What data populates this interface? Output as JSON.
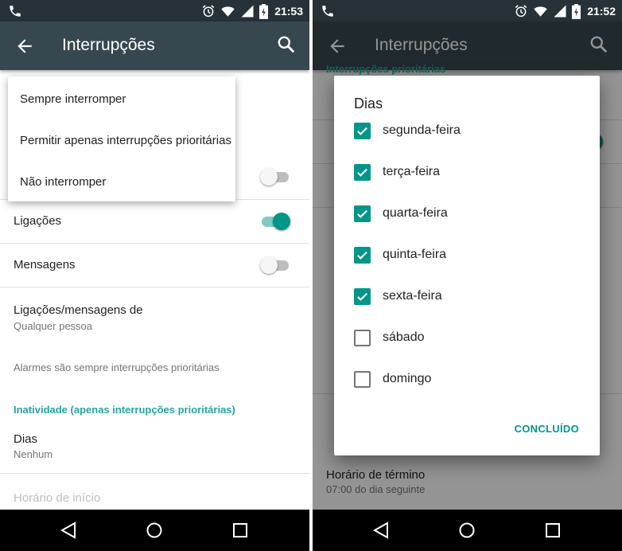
{
  "left_screen": {
    "status": {
      "time": "21:53"
    },
    "appbar": {
      "title": "Interrupções"
    },
    "dropdown": {
      "items": [
        "Sempre interromper",
        "Permitir apenas interrupções prioritárias",
        "Não interromper"
      ]
    },
    "rows": {
      "eventos_toggle": false,
      "ligacoes": {
        "title": "Ligações",
        "on": true
      },
      "mensagens": {
        "title": "Mensagens",
        "on": false
      },
      "ligacoes_mensagens_de": {
        "title": "Ligações/mensagens de",
        "subtitle": "Qualquer pessoa"
      },
      "note": "Alarmes são sempre interrupções prioritárias",
      "section_header": "Inatividade (apenas interrupções prioritárias)",
      "dias": {
        "title": "Dias",
        "subtitle": "Nenhum"
      },
      "horario_inicio": {
        "title": "Horário de início"
      }
    }
  },
  "right_screen": {
    "status": {
      "time": "21:52"
    },
    "appbar": {
      "title": "Interrupções"
    },
    "background": {
      "section_header_partial": "Interrupções prioritárias",
      "horario_termino": {
        "title": "Horário de término",
        "subtitle": "07:00 do dia seguinte"
      }
    },
    "dialog": {
      "title": "Dias",
      "days": [
        {
          "label": "segunda-feira",
          "checked": true
        },
        {
          "label": "terça-feira",
          "checked": true
        },
        {
          "label": "quarta-feira",
          "checked": true
        },
        {
          "label": "quinta-feira",
          "checked": true
        },
        {
          "label": "sexta-feira",
          "checked": true
        },
        {
          "label": "sábado",
          "checked": false
        },
        {
          "label": "domingo",
          "checked": false
        }
      ],
      "button": "CONCLUÍDO"
    }
  },
  "colors": {
    "accent": "#009688",
    "section_header": "#26a69a",
    "appbar": "#37474f",
    "statusbar": "#263238"
  },
  "icons": [
    "phone-icon",
    "alarm-icon",
    "wifi-icon",
    "signal-icon",
    "battery-icon",
    "back-arrow-icon",
    "search-icon",
    "nav-back-icon",
    "nav-home-icon",
    "nav-recent-icon",
    "check-icon"
  ]
}
